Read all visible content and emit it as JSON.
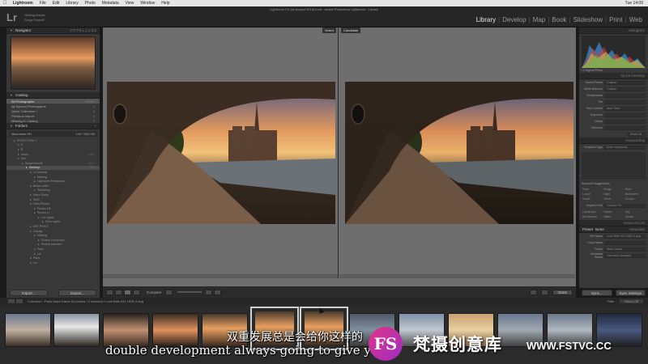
{
  "app": {
    "window_title": "Lightroom CC (at August 2016).lrcat - Adobe Photoshop Lightroom - Library",
    "logo": "Lr",
    "identity_line1": "Serge Ramelli",
    "identity_line2": "Getting Ahead"
  },
  "mac_menu": {
    "app_name": "Lightroom",
    "items": [
      "File",
      "Edit",
      "Library",
      "Photo",
      "Metadata",
      "View",
      "Window",
      "Help"
    ],
    "clock": "Tue 14:09"
  },
  "modules": {
    "items": [
      "Library",
      "Develop",
      "Map",
      "Book",
      "Slideshow",
      "Print",
      "Web"
    ],
    "active": "Library"
  },
  "left_panel": {
    "navigator_title": "Navigator",
    "navigator_zoom": "FIT  FILL  1:1  3:1",
    "catalog_title": "Catalog",
    "catalog_items": [
      {
        "label": "All Photographs",
        "count": "56281"
      },
      {
        "label": "All Synced Photographs",
        "count": "0"
      },
      {
        "label": "Quick Collection +",
        "count": "0"
      },
      {
        "label": "Previous Import",
        "count": "0"
      },
      {
        "label": "Missing in Catalog",
        "count": "0"
      }
    ],
    "folders_title": "Folders",
    "volume_label": "Macintosh HD",
    "volume_info": "143 / 500 GB",
    "tree": [
      {
        "label": "FRONT DISK 2",
        "count": "",
        "indent": 1
      },
      {
        "label": "A",
        "count": "",
        "indent": 2
      },
      {
        "label": "B",
        "count": "",
        "indent": 2
      },
      {
        "label": "Users",
        "count": "4417",
        "indent": 2
      },
      {
        "label": "Moi",
        "count": "",
        "indent": 2
      },
      {
        "label": "SergeRamelli",
        "count": "4417",
        "indent": 3
      },
      {
        "label": "Desktop",
        "count": "292",
        "indent": 4
      },
      {
        "label": "Lr Develop",
        "count": "",
        "indent": 5
      },
      {
        "label": "Missing",
        "count": "",
        "indent": 6
      },
      {
        "label": "Lightroom Photoshop",
        "count": "",
        "indent": 6
      },
      {
        "label": "Before After",
        "count": "",
        "indent": 5
      },
      {
        "label": "Workshop",
        "count": "",
        "indent": 6
      },
      {
        "label": "Notre Dame",
        "count": "",
        "indent": 5
      },
      {
        "label": "HDR",
        "count": "",
        "indent": 5
      },
      {
        "label": "Paris Photos",
        "count": "",
        "indent": 5
      },
      {
        "label": "Photos LR",
        "count": "",
        "indent": 6
      },
      {
        "label": "Photos Lr",
        "count": "",
        "indent": 6
      },
      {
        "label": "Lrs Lights",
        "count": "",
        "indent": 7
      },
      {
        "label": "Tiers Lights",
        "count": "",
        "indent": 8
      },
      {
        "label": "ART PRINT",
        "count": "",
        "indent": 5
      },
      {
        "label": "Leipzig",
        "count": "",
        "indent": 5
      },
      {
        "label": "Missing",
        "count": "",
        "indent": 6
      },
      {
        "label": "Photos connected",
        "count": "",
        "indent": 7
      },
      {
        "label": "Photos selected",
        "count": "",
        "indent": 7
      },
      {
        "label": "Paris",
        "count": "",
        "indent": 6
      },
      {
        "label": "Lrx",
        "count": "",
        "indent": 6
      },
      {
        "label": "Paris",
        "count": "",
        "indent": 5
      },
      {
        "label": "Lrx",
        "count": "",
        "indent": 5
      }
    ],
    "import_label": "Import...",
    "export_label": "Export..."
  },
  "compare": {
    "select_tag": "Select",
    "candidate_tag": "Candidate"
  },
  "toolbar": {
    "compare_label": "Compare",
    "done_label": "Done"
  },
  "right_panel": {
    "histogram_title": "Histogram",
    "original_photo_label": "Original Photo",
    "quick_develop_title": "Quick Develop",
    "saved_preset_label": "Saved Preset",
    "saved_preset_value": "Custom",
    "white_balance_label": "White Balance",
    "white_balance_value": "Custom",
    "temperature_label": "Temperature",
    "tint_label": "Tint",
    "tone_control_label": "Tone Control",
    "tone_control_value": "Auto Tone",
    "exposure_label": "Exposure",
    "clarity_label": "Clarity",
    "vibrance_label": "Vibrance",
    "reset_all_label": "Reset All",
    "keywording_title": "Keywording",
    "keyword_tags_label": "Keyword Tags",
    "keyword_tags_value": "Enter Keywords",
    "keyword_suggestions_label": "Keyword Suggestions",
    "suggestions": [
      "Paris",
      "Bridge",
      "River",
      "Louvre",
      "Night",
      "Monument",
      "Travel",
      "Street",
      "Europe"
    ],
    "keyword_set_label": "Keyword Set",
    "keyword_set_value": "Outdoor Ph",
    "keyword_set_items": [
      "Landscape",
      "Nature",
      "Sky",
      "Architecture",
      "Water",
      "Sunset"
    ],
    "keyword_list_title": "Keyword List",
    "metadata_title": "Metadata",
    "metadata_preset_label": "Preset",
    "metadata_preset_value": "None",
    "metadata_rows": [
      {
        "label": "File Name",
        "value": "Lumi Bitte 541 HDR-3.dng"
      },
      {
        "label": "Copy Name",
        "value": ""
      },
      {
        "label": "Folder",
        "value": "Notre Dame"
      },
      {
        "label": "Metadata Status",
        "value": "Has been changed"
      }
    ],
    "sync_label": "Sync...",
    "sync_settings_label": "Sync Settings"
  },
  "filmstrip_bar": {
    "source_text": "Collection : Paris Notre Dame    24 photos / 2 selected / Lumi Bitte 541 HDR-3.dng",
    "filter_label": "Filter :",
    "filter_value": "Filters Off"
  },
  "subtitles": {
    "cn": "双重发展总是会给你这样的",
    "en": "double development always going to give yo"
  },
  "watermark": {
    "logo_text": "FS",
    "text": "梵摄创意库",
    "url": "WWW.FSTVC.CC"
  }
}
